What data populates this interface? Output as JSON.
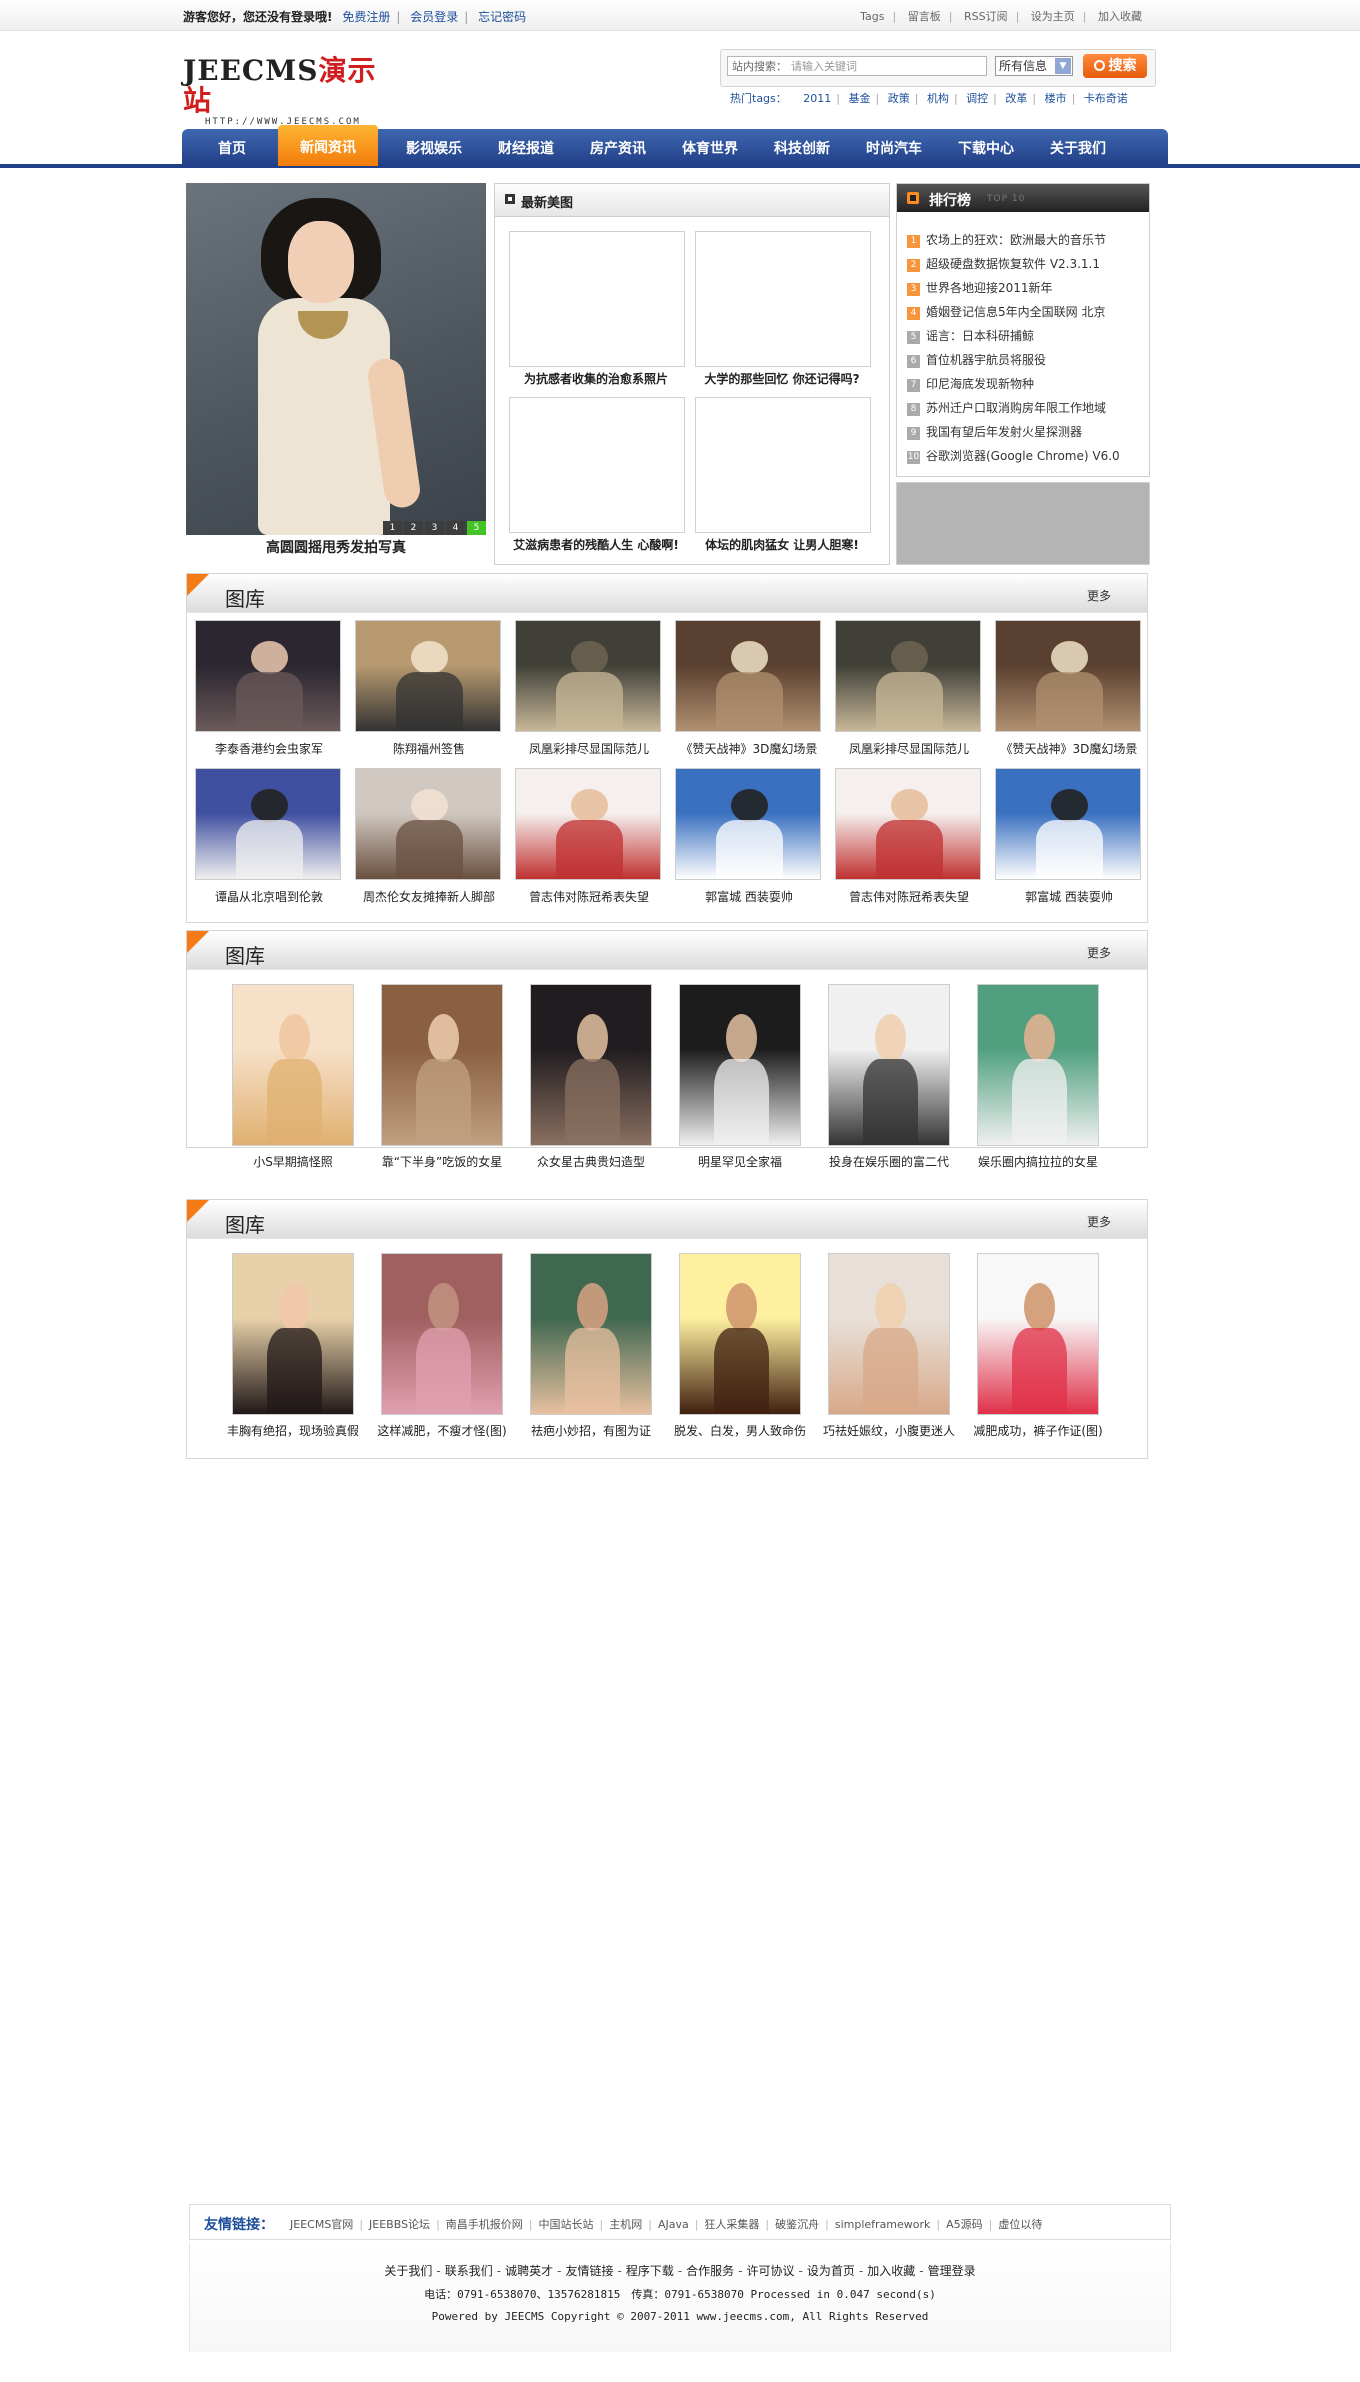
{
  "topbar": {
    "greeting": "游客您好，您还没有登录哦!",
    "register": "免费注册",
    "login": "会员登录",
    "forgot": "忘记密码",
    "right_links": [
      "Tags",
      "留言板",
      "RSS订阅",
      "设为主页",
      "加入收藏"
    ]
  },
  "logo": {
    "brand": "JEECMS",
    "brand_cn": "演示站",
    "url": "HTTP://WWW.JEECMS.COM"
  },
  "search": {
    "label": "站内搜索：",
    "placeholder": "请输入关键词",
    "select_value": "所有信息",
    "button": "搜索",
    "hot_label": "热门tags：",
    "hot_tags": [
      "2011",
      "基金",
      "政策",
      "机构",
      "调控",
      "改革",
      "楼市",
      "卡布奇诺"
    ]
  },
  "nav": {
    "items": [
      "首页",
      "新闻资讯",
      "影视娱乐",
      "财经报道",
      "房产资讯",
      "体育世界",
      "科技创新",
      "时尚汽车",
      "下载中心",
      "关于我们"
    ],
    "active": "新闻资讯"
  },
  "focus": {
    "caption": "高圆圆摇甩秀发拍写真",
    "pages": [
      "1",
      "2",
      "3",
      "4",
      "5"
    ],
    "active_page": "5"
  },
  "newpics": {
    "title": "最新美图",
    "items": [
      "为抗感者收集的治愈系照片",
      "大学的那些回忆 你还记得吗?",
      "艾滋病患者的残酷人生 心酸啊!",
      "体坛的肌肉猛女 让男人胆寒!"
    ]
  },
  "rank": {
    "title": "排行榜",
    "subtitle": "TOP 10",
    "items": [
      {
        "n": "1",
        "t": "农场上的狂欢：欧洲最大的音乐节"
      },
      {
        "n": "2",
        "t": "超级硬盘数据恢复软件 V2.3.1.1"
      },
      {
        "n": "3",
        "t": "世界各地迎接2011新年"
      },
      {
        "n": "4",
        "t": "婚姻登记信息5年内全国联网 北京"
      },
      {
        "n": "5",
        "t": "谣言：日本科研捕鲸"
      },
      {
        "n": "6",
        "t": "首位机器宇航员将服役"
      },
      {
        "n": "7",
        "t": "印尼海底发现新物种"
      },
      {
        "n": "8",
        "t": "苏州迁户口取消购房年限工作地域"
      },
      {
        "n": "9",
        "t": "我国有望后年发射火星探测器"
      },
      {
        "n": "10",
        "t": "谷歌浏览器(Google Chrome) V6.0"
      }
    ]
  },
  "galleries": [
    {
      "title": "图库",
      "more": "更多",
      "items": [
        "李泰香港约会虫家军",
        "陈翔福州签售",
        "凤凰彩排尽显国际范儿",
        "《赞天战神》3D魔幻场景",
        "凤凰彩排尽显国际范儿",
        "《赞天战神》3D魔幻场景",
        "谭晶从北京唱到伦敦",
        "周杰伦女友摊捧新人脚部",
        "曾志伟对陈冠希表失望",
        "郭富城 西装耍帅",
        "曾志伟对陈冠希表失望",
        "郭富城 西装耍帅"
      ]
    },
    {
      "title": "图库",
      "more": "更多",
      "items": [
        "小S早期搞怪照",
        "靠“下半身”吃饭的女星",
        "众女星古典贵妇造型",
        "明星罕见全家福",
        "投身在娱乐圈的富二代",
        "娱乐圈内搞拉拉的女星"
      ]
    },
    {
      "title": "图库",
      "more": "更多",
      "items": [
        "丰胸有绝招，现场验真假",
        "这样减肥，不瘦才怪(图)",
        "祛疤小妙招，有图为证",
        "脱发、白发，男人致命伤",
        "巧祛妊娠纹，小腹更迷人",
        "减肥成功，裤子作证(图)"
      ]
    }
  ],
  "links": {
    "label": "友情链接：",
    "items": [
      "JEECMS官网",
      "JEEBBS论坛",
      "南昌手机报价网",
      "中国站长站",
      "主机网",
      "AJava",
      "狂人采集器",
      "破鉴沉舟",
      "simpleframework",
      "A5源码",
      "虚位以待"
    ]
  },
  "footer": {
    "nav": [
      "关于我们",
      "联系我们",
      "诚聘英才",
      "友情链接",
      "程序下载",
      "合作服务",
      "许可协议",
      "设为首页",
      "加入收藏",
      "管理登录"
    ],
    "contact": "电话：0791-6538070、13576281815　传真：0791-6538070 Processed in 0.047 second(s)",
    "copyright": "Powered by JEECMS Copyright © 2007-2011 www.jeecms.com, All Rights Reserved"
  },
  "colors": {
    "nav_blue": "#2b4b98",
    "nav_active": "#f39217",
    "accent_orange": "#f47b15",
    "link_blue": "#1e4f9c"
  }
}
